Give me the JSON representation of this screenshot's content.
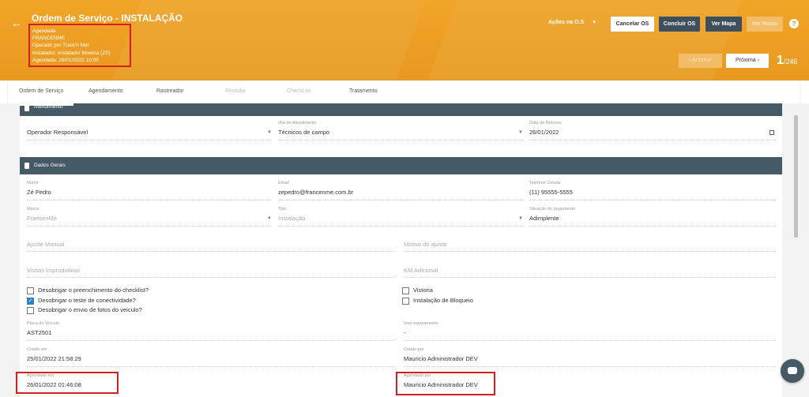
{
  "header": {
    "back_glyph": "←",
    "title": "Ordem de Serviço - INSTALAÇÃO",
    "info": [
      "Agendada",
      "FRANCENME",
      "Operado por Track'n Mel",
      "Instalador: Instalador Moema (ZS)",
      "Agendada: 26/01/2022 10:00"
    ],
    "acoes_label": "Ações na O.S",
    "cancel_label": "Cancelar OS",
    "concluir_label": "Concluir OS",
    "mapa_label": "Ver Mapa",
    "rotas_label": "Ver Rotas",
    "help_glyph": "?",
    "anterior_label": "‹  Anterior",
    "proxima_label": "Próxima  ›",
    "page_current": "1",
    "page_total": "/246"
  },
  "tabs": [
    {
      "label": "Ordem de Serviço"
    },
    {
      "label": "Agendamento"
    },
    {
      "label": "Rastreador"
    },
    {
      "label": "Revisão"
    },
    {
      "label": "CheckList"
    },
    {
      "label": "Tratamento"
    }
  ],
  "atendimento": {
    "header": "Atendimento",
    "operador": {
      "label": "",
      "value": "Operador Responsável"
    },
    "ilha": {
      "label": "Ilha de Atendimento",
      "value": "Técnicos de campo"
    },
    "retorno": {
      "label": "Data de Retorno",
      "value": "26/01/2022"
    }
  },
  "dados": {
    "header": "Dados Gerais",
    "nome": {
      "label": "Nome",
      "value": "Zé Pedro"
    },
    "email": {
      "label": "Email",
      "value": "zepedro@francenme.com.br"
    },
    "telefone": {
      "label": "Telefone Celular",
      "value": "(11) 95555-5555"
    },
    "marca": {
      "label": "Marca",
      "value": "FrancenMe"
    },
    "tipo": {
      "label": "Tipo",
      "value": "Instalação"
    },
    "situacao": {
      "label": "Situação do pagamento",
      "value": "Adimplente"
    },
    "ajuste_placeholder": "Ajuste Manual",
    "motivo_placeholder": "Motivo do ajuste",
    "visitas_placeholder": "Visitas Improdutivas",
    "km_placeholder": "KM Adicional",
    "checks": [
      {
        "label": "Desobrigar o preenchimento do checklist?",
        "checked": false
      },
      {
        "label": "Desobrigar o teste de conectividade?",
        "checked": true
      },
      {
        "label": "Desobrigar o envio de fotos do veiculo?",
        "checked": false
      }
    ],
    "checks_right": [
      {
        "label": "Vistoria",
        "checked": false
      },
      {
        "label": "Instalação de Bloqueio",
        "checked": false
      }
    ],
    "placa": {
      "label": "Placa do Veículo",
      "value": "AST2501"
    },
    "imei": {
      "label": "Imei equipamento",
      "value": "-"
    },
    "criado_em": {
      "label": "Criado em",
      "value": "25/01/2022 21:58:29"
    },
    "criado_por": {
      "label": "Criado por",
      "value": "Mauricio Administrador DEV"
    },
    "agendado_em": {
      "label": "Agendado em",
      "value": "26/01/2022 01:46:08"
    },
    "agendado_por": {
      "label": "Agendado por",
      "value": "Mauricio Administrador DEV"
    }
  },
  "colors": {
    "header_orange": "#e89a20",
    "section_dark": "#455a64",
    "highlight_red": "#d42020",
    "check_blue": "#2f82c4"
  }
}
